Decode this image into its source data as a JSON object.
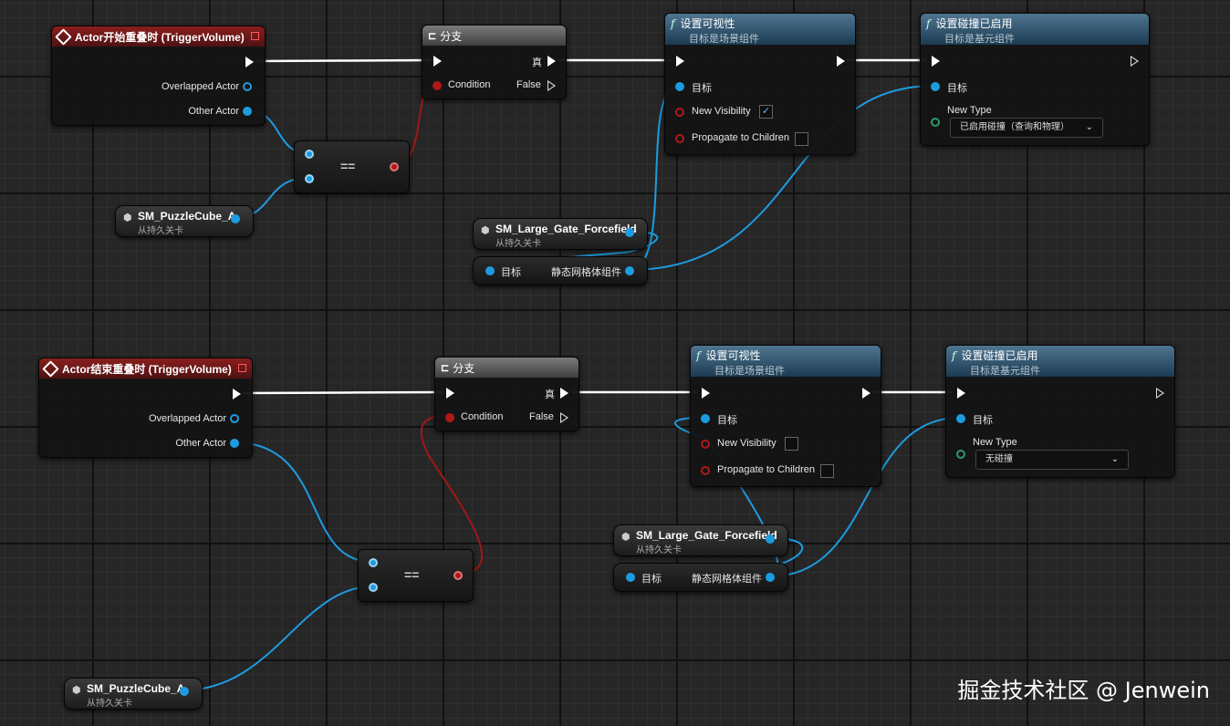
{
  "colors": {
    "exec_wire": "#ffffff",
    "object_wire": "#1d9be0",
    "bool_wire": "#a01818",
    "event_header": "#7a1a1a",
    "func_header": "#3d6480",
    "branch_header": "#5a5a5a"
  },
  "top": {
    "event": {
      "title": "Actor开始重叠时 (TriggerVolume)",
      "overlapped": "Overlapped Actor",
      "other": "Other Actor"
    },
    "branch": {
      "title": "分支",
      "condition": "Condition",
      "true_label": "真",
      "false_label": "False"
    },
    "equals": {
      "label": "=="
    },
    "cube_var": {
      "name": "SM_PuzzleCube_A",
      "sub": "从持久关卡"
    },
    "gate_var": {
      "name": "SM_Large_Gate_Forcefield",
      "sub": "从持久关卡"
    },
    "get_comp": {
      "target": "目标",
      "output": "静态网格体组件"
    },
    "set_vis": {
      "title": "设置可视性",
      "subtitle": "目标是场景组件",
      "target": "目标",
      "new_vis": "New Visibility",
      "new_vis_checked": "✓",
      "propagate": "Propagate to Children"
    },
    "set_coll": {
      "title": "设置碰撞已启用",
      "subtitle": "目标是基元组件",
      "target": "目标",
      "new_type": "New Type",
      "dropdown": "已启用碰撞（查询和物理）"
    }
  },
  "bottom": {
    "event": {
      "title": "Actor结束重叠时 (TriggerVolume)",
      "overlapped": "Overlapped Actor",
      "other": "Other Actor"
    },
    "branch": {
      "title": "分支",
      "condition": "Condition",
      "true_label": "真",
      "false_label": "False"
    },
    "equals": {
      "label": "=="
    },
    "cube_var": {
      "name": "SM_PuzzleCube_A",
      "sub": "从持久关卡"
    },
    "gate_var": {
      "name": "SM_Large_Gate_Forcefield",
      "sub": "从持久关卡"
    },
    "get_comp": {
      "target": "目标",
      "output": "静态网格体组件"
    },
    "set_vis": {
      "title": "设置可视性",
      "subtitle": "目标是场景组件",
      "target": "目标",
      "new_vis": "New Visibility",
      "new_vis_checked": "",
      "propagate": "Propagate to Children"
    },
    "set_coll": {
      "title": "设置碰撞已启用",
      "subtitle": "目标是基元组件",
      "target": "目标",
      "new_type": "New Type",
      "dropdown": "无碰撞"
    }
  },
  "icons": {
    "function": "function-icon",
    "event": "event-icon",
    "branch": "branch-icon",
    "cube": "cube-icon",
    "dropdown": "chevron-down-icon"
  },
  "watermark": "掘金技术社区 @ Jenwein"
}
